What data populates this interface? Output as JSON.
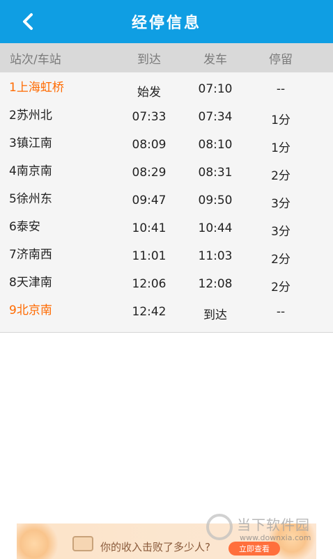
{
  "header": {
    "title": "经停信息",
    "back_icon": "chevron-left-icon",
    "bg_color": "#0f9ee3"
  },
  "columns": {
    "station": "站次/车站",
    "arrive": "到达",
    "depart": "发车",
    "stay": "停留"
  },
  "stops": [
    {
      "no": "1",
      "name": "上海虹桥",
      "arrive": "始发",
      "depart": "07:10",
      "stay": "--",
      "highlight": true
    },
    {
      "no": "2",
      "name": "苏州北",
      "arrive": "07:33",
      "depart": "07:34",
      "stay": "1分",
      "highlight": false
    },
    {
      "no": "3",
      "name": "镇江南",
      "arrive": "08:09",
      "depart": "08:10",
      "stay": "1分",
      "highlight": false
    },
    {
      "no": "4",
      "name": "南京南",
      "arrive": "08:29",
      "depart": "08:31",
      "stay": "2分",
      "highlight": false
    },
    {
      "no": "5",
      "name": "徐州东",
      "arrive": "09:47",
      "depart": "09:50",
      "stay": "3分",
      "highlight": false
    },
    {
      "no": "6",
      "name": "泰安",
      "arrive": "10:41",
      "depart": "10:44",
      "stay": "3分",
      "highlight": false
    },
    {
      "no": "7",
      "name": "济南西",
      "arrive": "11:01",
      "depart": "11:03",
      "stay": "2分",
      "highlight": false
    },
    {
      "no": "8",
      "name": "天津南",
      "arrive": "12:06",
      "depart": "12:08",
      "stay": "2分",
      "highlight": false
    },
    {
      "no": "9",
      "name": "北京南",
      "arrive": "12:42",
      "depart": "到达",
      "stay": "--",
      "highlight": true
    }
  ],
  "colors": {
    "highlight": "#ff6a00",
    "header_row_bg": "#d9d9d9",
    "body_bg": "#f5f5f5"
  },
  "ad": {
    "text": "你的收入击败了多少人?",
    "cta": "立即查看"
  },
  "watermark": {
    "text": "当下软件园",
    "url": "www.downxia.com"
  }
}
